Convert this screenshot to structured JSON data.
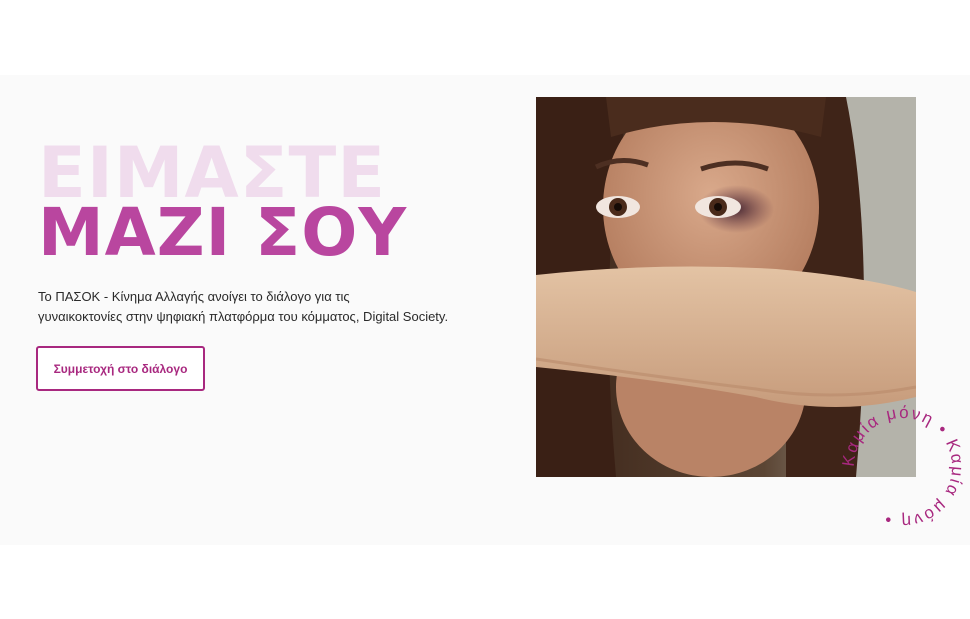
{
  "hero": {
    "headline_line1": "ΕΙΜΑΣΤΕ",
    "headline_line2": "ΜΑΖΙ ΣΟΥ",
    "intro_line1": "Το ΠΑΣΟΚ - Κίνημα Αλλαγής ανοίγει το διάλογο για τις",
    "intro_line2": "γυναικοκτονίες στην ψηφιακή πλατφόρμα του κόμματος, Digital Society.",
    "cta_label": "Συμμετοχή στο διάλογο"
  },
  "badge": {
    "text": "Καμία μόνη • Καμία μόνη •"
  },
  "colors": {
    "accent": "#a8287f",
    "headline_light": "#f0dced",
    "headline_strong": "#b9469f",
    "background": "#fafafa"
  }
}
